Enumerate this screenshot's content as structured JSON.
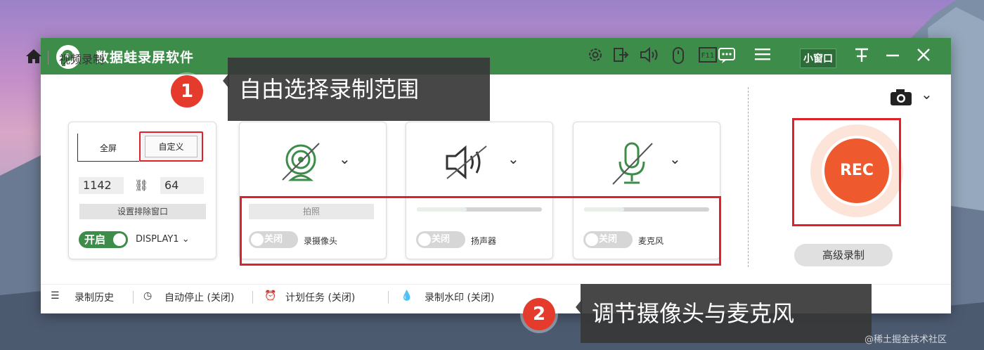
{
  "window": {
    "app_title": "数据蛙录屏软件",
    "mini_window_label": "小窗口",
    "icons": [
      "message-icon",
      "menu-icon",
      "pin-icon",
      "minimize-icon",
      "close-icon"
    ]
  },
  "breadcrumb": {
    "current": "视频录制"
  },
  "annotations": {
    "step1_number": "1",
    "step1_text": "自由选择录制范围",
    "step2_number": "2",
    "step2_text": "调节摄像头与麦克风"
  },
  "toolbar": {
    "icons": [
      "gear-icon",
      "export-icon",
      "speaker-icon",
      "mouse-icon",
      "f11-icon"
    ],
    "f11_label": "F11"
  },
  "range_panel": {
    "fullscreen_label": "全屏",
    "custom_label": "自定义",
    "width": "1142",
    "height": "64",
    "exclude_window_label": "设置排除窗口",
    "toggle_label": "开启",
    "display_label": "DISPLAY1 ⌄"
  },
  "devices": {
    "camera": {
      "name": "录摄像头",
      "toggle": "关闭",
      "photo_label": "拍照"
    },
    "speaker": {
      "name": "扬声器",
      "toggle": "关闭"
    },
    "microphone": {
      "name": "麦克风",
      "toggle": "关闭"
    }
  },
  "rec_button_label": "REC",
  "advanced_record_label": "高级录制",
  "bottom_bar": {
    "history": "录制历史",
    "auto_stop": "自动停止 (关闭)",
    "schedule": "计划任务 (关闭)",
    "watermark": "录制水印 (关闭)"
  },
  "watermark_text": "@稀土掘金技术社区",
  "colors": {
    "brand_green": "#3d8c4a",
    "rec_orange": "#ee5a2e",
    "highlight_red": "#e0202a"
  }
}
